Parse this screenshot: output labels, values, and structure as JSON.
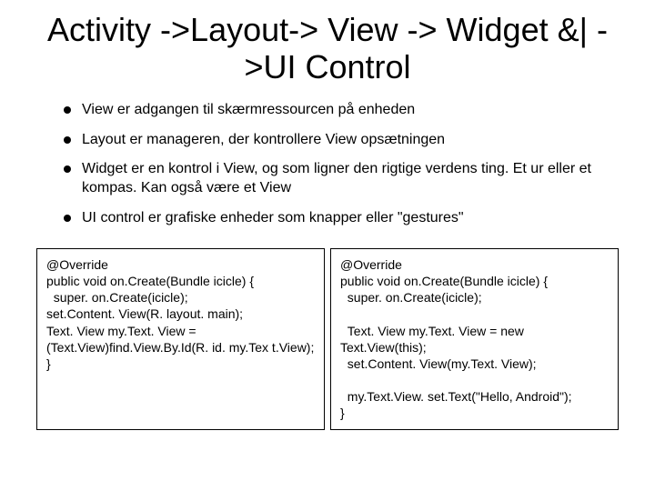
{
  "title": "Activity ->Layout-> View -> Widget  &|  ->UI Control",
  "bullets": [
    "View er adgangen til skærmressourcen på enheden",
    "Layout er manageren, der kontrollere View opsætningen",
    "Widget er en kontrol i View, og som ligner den rigtige verdens ting. Et ur eller et kompas. Kan også være et View",
    "UI control er grafiske enheder som knapper eller \"gestures\""
  ],
  "code_left": "@Override\npublic void on.Create(Bundle icicle) {\n  super. on.Create(icicle);\nset.Content. View(R. layout. main);\nText. View my.Text. View = (Text.View)find.View.By.Id(R. id. my.Tex t.View);\n}",
  "code_right": "@Override\npublic void on.Create(Bundle icicle) {\n  super. on.Create(icicle);\n\n  Text. View my.Text. View = new Text.View(this);\n  set.Content. View(my.Text. View);\n\n  my.Text.View. set.Text(\"Hello, Android\");\n}"
}
